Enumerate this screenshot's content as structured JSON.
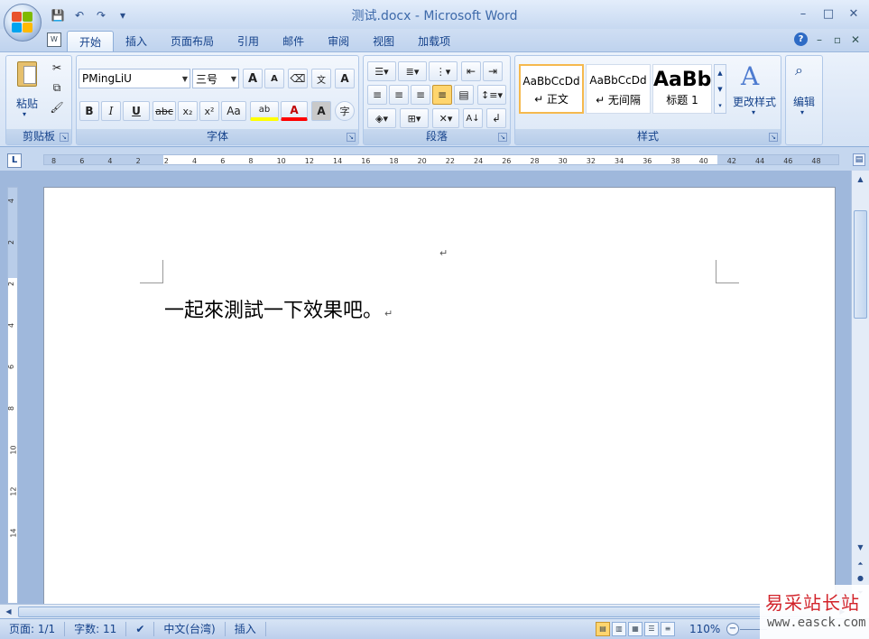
{
  "window": {
    "title": "测试.docx - Microsoft Word",
    "minimize": "–",
    "maximize": "□",
    "close": "✕"
  },
  "qat": {
    "save": "💾",
    "undo": "↶",
    "redo": "↷",
    "more": "▾"
  },
  "tabs": [
    {
      "label": "开始",
      "active": true
    },
    {
      "label": "插入"
    },
    {
      "label": "页面布局"
    },
    {
      "label": "引用"
    },
    {
      "label": "邮件"
    },
    {
      "label": "审阅"
    },
    {
      "label": "视图"
    },
    {
      "label": "加载项"
    }
  ],
  "ribbon": {
    "clipboard": {
      "label": "剪贴板",
      "paste": "粘贴"
    },
    "font": {
      "label": "字体",
      "font_name": "PMingLiU",
      "font_size": "三号",
      "grow": "A",
      "shrink": "A",
      "bold": "B",
      "italic": "I",
      "underline": "U",
      "strike": "abc",
      "subscript": "x₂",
      "superscript": "x²",
      "change_case": "Aa",
      "highlight": "ab",
      "font_color": "A",
      "char_shading": "A",
      "enclose": "字",
      "phonetic": "文",
      "border": "A"
    },
    "paragraph": {
      "label": "段落"
    },
    "styles": {
      "label": "样式",
      "items": [
        {
          "sample": "AaBbCcDd",
          "name": "↵ 正文"
        },
        {
          "sample": "AaBbCcDd",
          "name": "↵ 无间隔"
        },
        {
          "sample": "AaBb",
          "name": "标题 1"
        }
      ],
      "change": "更改样式"
    },
    "editing": {
      "label": "编辑"
    }
  },
  "ruler": {
    "button": "L",
    "ticks": [
      "8",
      "6",
      "4",
      "2",
      "2",
      "4",
      "6",
      "8",
      "10",
      "12",
      "14",
      "16",
      "18",
      "20",
      "22",
      "24",
      "26",
      "28",
      "30",
      "32",
      "34",
      "36",
      "38",
      "40",
      "42",
      "44",
      "46",
      "48"
    ]
  },
  "vruler": {
    "ticks": [
      "4",
      "2",
      "2",
      "4",
      "6",
      "8",
      "10",
      "12",
      "14"
    ]
  },
  "document": {
    "text": "一起來測試一下效果吧。",
    "para_mark": "↵"
  },
  "statusbar": {
    "page": "页面: 1/1",
    "words": "字数: 11",
    "language": "中文(台湾)",
    "mode": "插入",
    "zoom": "110%"
  },
  "watermark": {
    "cn": "易采站长站",
    "url": "www.easck.com"
  }
}
